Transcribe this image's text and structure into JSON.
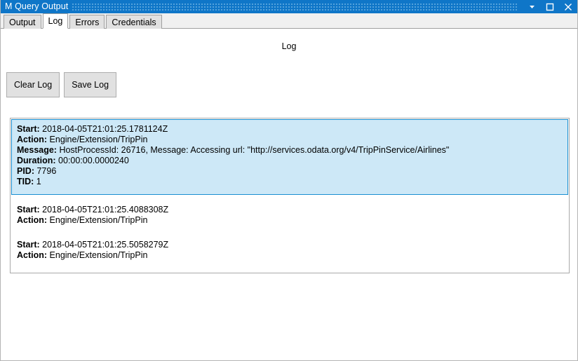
{
  "window": {
    "title": "M Query Output",
    "controls": [
      {
        "name": "dropdown-chevron",
        "glyph": "chevron-down-icon"
      },
      {
        "name": "maximize",
        "glyph": "maximize-icon"
      },
      {
        "name": "close",
        "glyph": "close-icon"
      }
    ],
    "titlebar_color": "#0f76c8",
    "titlebar_text_color": "#ffffff"
  },
  "tabs": [
    {
      "label": "Output",
      "active": false
    },
    {
      "label": "Log",
      "active": true
    },
    {
      "label": "Errors",
      "active": false
    },
    {
      "label": "Credentials",
      "active": false
    }
  ],
  "main": {
    "heading": "Log",
    "buttons": {
      "clear_log": "Clear Log",
      "save_log": "Save Log"
    },
    "selection_color": "#cde8f7",
    "selection_border_color": "#1a8fd1",
    "entries": [
      {
        "selected": true,
        "fields": [
          {
            "key": "Start:",
            "value": "2018-04-05T21:01:25.1781124Z"
          },
          {
            "key": "Action:",
            "value": "Engine/Extension/TripPin"
          },
          {
            "key": "Message:",
            "value": "HostProcessId: 26716, Message: Accessing url: \"http://services.odata.org/v4/TripPinService/Airlines\""
          },
          {
            "key": "Duration:",
            "value": "00:00:00.0000240"
          },
          {
            "key": "PID:",
            "value": "7796"
          },
          {
            "key": "TID:",
            "value": "1"
          }
        ]
      },
      {
        "selected": false,
        "fields": [
          {
            "key": "Start:",
            "value": "2018-04-05T21:01:25.4088308Z"
          },
          {
            "key": "Action:",
            "value": "Engine/Extension/TripPin"
          }
        ]
      },
      {
        "selected": false,
        "fields": [
          {
            "key": "Start:",
            "value": "2018-04-05T21:01:25.5058279Z"
          },
          {
            "key": "Action:",
            "value": "Engine/Extension/TripPin"
          }
        ]
      }
    ]
  }
}
